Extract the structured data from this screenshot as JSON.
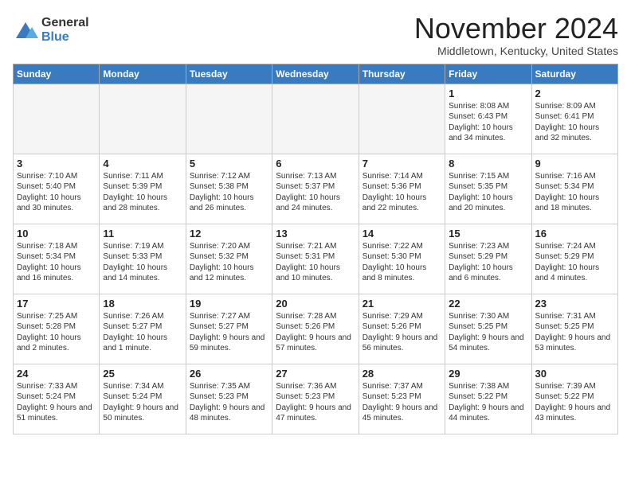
{
  "header": {
    "logo": {
      "general": "General",
      "blue": "Blue"
    },
    "title": "November 2024",
    "location": "Middletown, Kentucky, United States"
  },
  "days_of_week": [
    "Sunday",
    "Monday",
    "Tuesday",
    "Wednesday",
    "Thursday",
    "Friday",
    "Saturday"
  ],
  "weeks": [
    [
      {
        "day": "",
        "info": ""
      },
      {
        "day": "",
        "info": ""
      },
      {
        "day": "",
        "info": ""
      },
      {
        "day": "",
        "info": ""
      },
      {
        "day": "",
        "info": ""
      },
      {
        "day": "1",
        "info": "Sunrise: 8:08 AM\nSunset: 6:43 PM\nDaylight: 10 hours and 34 minutes."
      },
      {
        "day": "2",
        "info": "Sunrise: 8:09 AM\nSunset: 6:41 PM\nDaylight: 10 hours and 32 minutes."
      }
    ],
    [
      {
        "day": "3",
        "info": "Sunrise: 7:10 AM\nSunset: 5:40 PM\nDaylight: 10 hours and 30 minutes."
      },
      {
        "day": "4",
        "info": "Sunrise: 7:11 AM\nSunset: 5:39 PM\nDaylight: 10 hours and 28 minutes."
      },
      {
        "day": "5",
        "info": "Sunrise: 7:12 AM\nSunset: 5:38 PM\nDaylight: 10 hours and 26 minutes."
      },
      {
        "day": "6",
        "info": "Sunrise: 7:13 AM\nSunset: 5:37 PM\nDaylight: 10 hours and 24 minutes."
      },
      {
        "day": "7",
        "info": "Sunrise: 7:14 AM\nSunset: 5:36 PM\nDaylight: 10 hours and 22 minutes."
      },
      {
        "day": "8",
        "info": "Sunrise: 7:15 AM\nSunset: 5:35 PM\nDaylight: 10 hours and 20 minutes."
      },
      {
        "day": "9",
        "info": "Sunrise: 7:16 AM\nSunset: 5:34 PM\nDaylight: 10 hours and 18 minutes."
      }
    ],
    [
      {
        "day": "10",
        "info": "Sunrise: 7:18 AM\nSunset: 5:34 PM\nDaylight: 10 hours and 16 minutes."
      },
      {
        "day": "11",
        "info": "Sunrise: 7:19 AM\nSunset: 5:33 PM\nDaylight: 10 hours and 14 minutes."
      },
      {
        "day": "12",
        "info": "Sunrise: 7:20 AM\nSunset: 5:32 PM\nDaylight: 10 hours and 12 minutes."
      },
      {
        "day": "13",
        "info": "Sunrise: 7:21 AM\nSunset: 5:31 PM\nDaylight: 10 hours and 10 minutes."
      },
      {
        "day": "14",
        "info": "Sunrise: 7:22 AM\nSunset: 5:30 PM\nDaylight: 10 hours and 8 minutes."
      },
      {
        "day": "15",
        "info": "Sunrise: 7:23 AM\nSunset: 5:29 PM\nDaylight: 10 hours and 6 minutes."
      },
      {
        "day": "16",
        "info": "Sunrise: 7:24 AM\nSunset: 5:29 PM\nDaylight: 10 hours and 4 minutes."
      }
    ],
    [
      {
        "day": "17",
        "info": "Sunrise: 7:25 AM\nSunset: 5:28 PM\nDaylight: 10 hours and 2 minutes."
      },
      {
        "day": "18",
        "info": "Sunrise: 7:26 AM\nSunset: 5:27 PM\nDaylight: 10 hours and 1 minute."
      },
      {
        "day": "19",
        "info": "Sunrise: 7:27 AM\nSunset: 5:27 PM\nDaylight: 9 hours and 59 minutes."
      },
      {
        "day": "20",
        "info": "Sunrise: 7:28 AM\nSunset: 5:26 PM\nDaylight: 9 hours and 57 minutes."
      },
      {
        "day": "21",
        "info": "Sunrise: 7:29 AM\nSunset: 5:26 PM\nDaylight: 9 hours and 56 minutes."
      },
      {
        "day": "22",
        "info": "Sunrise: 7:30 AM\nSunset: 5:25 PM\nDaylight: 9 hours and 54 minutes."
      },
      {
        "day": "23",
        "info": "Sunrise: 7:31 AM\nSunset: 5:25 PM\nDaylight: 9 hours and 53 minutes."
      }
    ],
    [
      {
        "day": "24",
        "info": "Sunrise: 7:33 AM\nSunset: 5:24 PM\nDaylight: 9 hours and 51 minutes."
      },
      {
        "day": "25",
        "info": "Sunrise: 7:34 AM\nSunset: 5:24 PM\nDaylight: 9 hours and 50 minutes."
      },
      {
        "day": "26",
        "info": "Sunrise: 7:35 AM\nSunset: 5:23 PM\nDaylight: 9 hours and 48 minutes."
      },
      {
        "day": "27",
        "info": "Sunrise: 7:36 AM\nSunset: 5:23 PM\nDaylight: 9 hours and 47 minutes."
      },
      {
        "day": "28",
        "info": "Sunrise: 7:37 AM\nSunset: 5:23 PM\nDaylight: 9 hours and 45 minutes."
      },
      {
        "day": "29",
        "info": "Sunrise: 7:38 AM\nSunset: 5:22 PM\nDaylight: 9 hours and 44 minutes."
      },
      {
        "day": "30",
        "info": "Sunrise: 7:39 AM\nSunset: 5:22 PM\nDaylight: 9 hours and 43 minutes."
      }
    ]
  ]
}
